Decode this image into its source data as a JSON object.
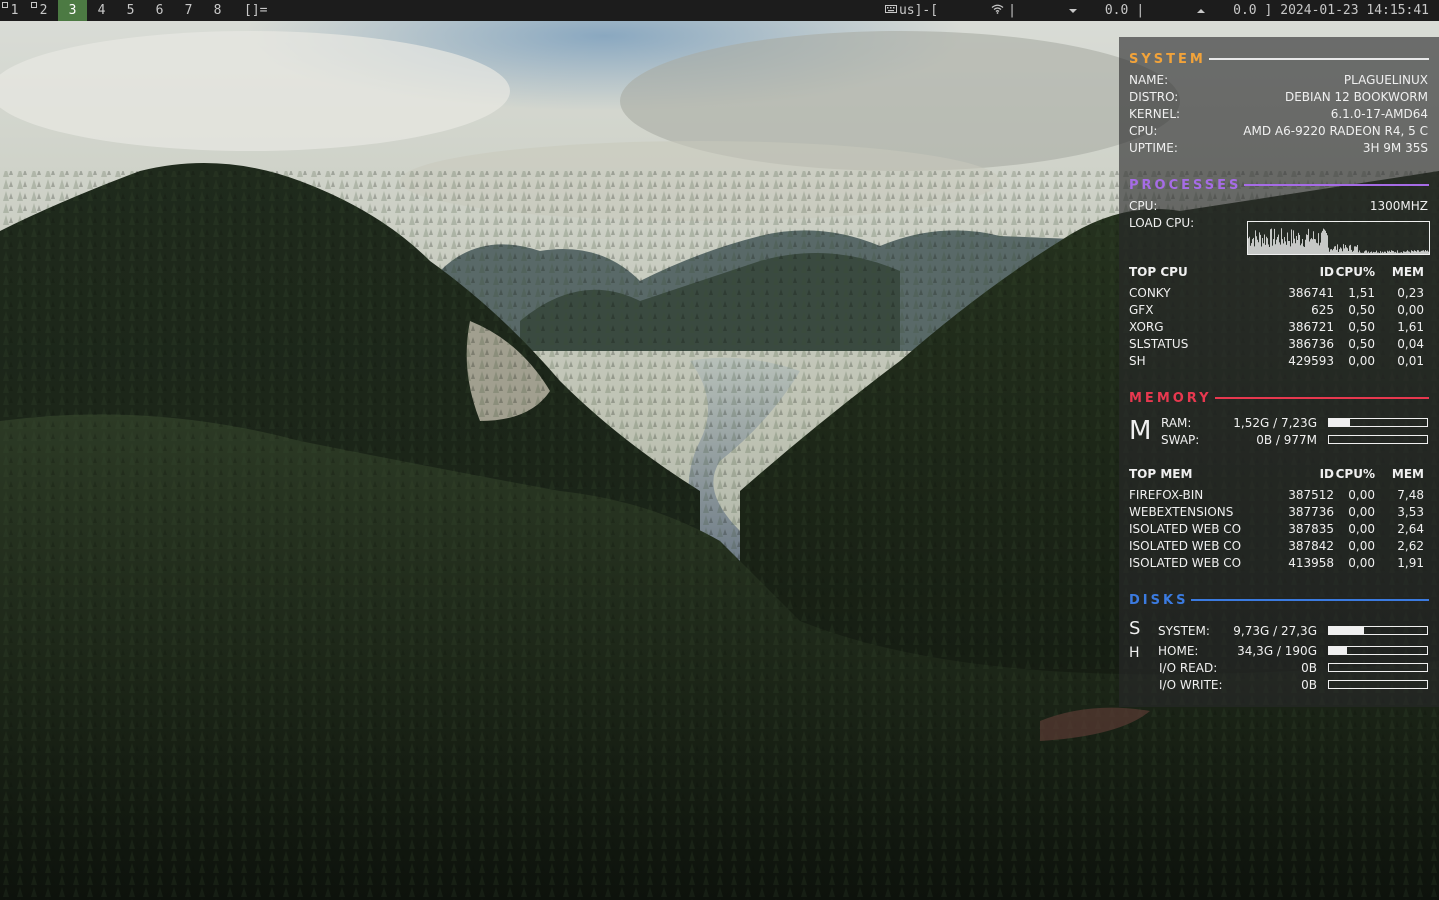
{
  "topbar": {
    "tags": [
      "1",
      "2",
      "3",
      "4",
      "5",
      "6",
      "7",
      "8"
    ],
    "occupied_tags": [
      "1",
      "2"
    ],
    "active_tag": "3",
    "layout_symbol": "[]=",
    "keyboard": "us]-[",
    "sep1": "|",
    "down_value": "0.0",
    "sep2": "|",
    "up_value": "0.0 ]",
    "datetime": "2024-01-23 14:15:41"
  },
  "conky": {
    "system": {
      "title": "SYSTEM",
      "color": "#f2a33a",
      "rows": [
        {
          "key": "NAME:",
          "value": "PLAGUELINUX"
        },
        {
          "key": "DISTRO:",
          "value": "DEBIAN 12 BOOKWORM"
        },
        {
          "key": "KERNEL:",
          "value": "6.1.0-17-AMD64"
        },
        {
          "key": "CPU:",
          "value": "AMD A6-9220 RADEON R4, 5 C"
        },
        {
          "key": "UPTIME:",
          "value": "3H 9M 35S"
        }
      ]
    },
    "processes": {
      "title": "PROCESSES",
      "color": "#a66ce6",
      "cpu_label": "CPU:",
      "cpu_value": "1300MHZ",
      "load_label": "LOAD CPU:",
      "top_cpu_header": [
        "TOP CPU",
        "ID",
        "CPU%",
        "MEM"
      ],
      "top_cpu": [
        [
          "CONKY",
          "386741",
          "1,51",
          "0,23"
        ],
        [
          "GFX",
          "625",
          "0,50",
          "0,00"
        ],
        [
          "XORG",
          "386721",
          "0,50",
          "1,61"
        ],
        [
          "SLSTATUS",
          "386736",
          "0,50",
          "0,04"
        ],
        [
          "SH",
          "429593",
          "0,00",
          "0,01"
        ]
      ]
    },
    "memory": {
      "title": "MEMORY",
      "color": "#e8384f",
      "glyph": "M",
      "ram_label": "RAM:",
      "ram_value": "1,52G / 7,23G",
      "ram_fraction": 0.21,
      "swap_label": "SWAP:",
      "swap_value": "0B / 977M",
      "swap_fraction": 0.0,
      "top_mem_header": [
        "TOP MEM",
        "ID",
        "CPU%",
        "MEM"
      ],
      "top_mem": [
        [
          "FIREFOX-BIN",
          "387512",
          "0,00",
          "7,48"
        ],
        [
          "WEBEXTENSIONS",
          "387736",
          "0,00",
          "3,53"
        ],
        [
          "ISOLATED WEB CO",
          "387835",
          "0,00",
          "2,64"
        ],
        [
          "ISOLATED WEB CO",
          "387842",
          "0,00",
          "2,62"
        ],
        [
          "ISOLATED WEB CO",
          "413958",
          "0,00",
          "1,91"
        ]
      ]
    },
    "disks": {
      "title": "DISKS",
      "color": "#3b7be0",
      "glyph_s": "S",
      "glyph_h": "H",
      "system_label": "SYSTEM:",
      "system_value": "9,73G / 27,3G",
      "system_fraction": 0.36,
      "home_label": "HOME:",
      "home_value": "34,3G / 190G",
      "home_fraction": 0.18,
      "read_label": "I/O READ:",
      "read_value": "0B",
      "read_fraction": 0.0,
      "write_label": "I/O WRITE:",
      "write_value": "0B",
      "write_fraction": 0.0
    }
  }
}
